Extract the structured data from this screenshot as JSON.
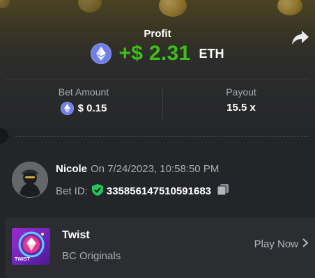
{
  "hero": {
    "title": "Profit",
    "profit_value": "+$ 2.31",
    "profit_unit": "ETH"
  },
  "stats": {
    "bet_amount_label": "Bet Amount",
    "bet_amount_value": "$ 0.15",
    "payout_label": "Payout",
    "payout_value": "15.5 x"
  },
  "user": {
    "name": "Nicole",
    "date": "On 7/24/2023, 10:58:50 PM",
    "bet_id_label": "Bet ID:",
    "bet_id": "335856147510591683"
  },
  "game": {
    "name": "Twist",
    "provider": "BC Originals",
    "thumb_label": "TWIST",
    "play_label": "Play Now"
  },
  "colors": {
    "profit_green": "#3bc117",
    "eth_blue": "#6f7fe3",
    "shield_green": "#22c55e",
    "background": "#232528",
    "card": "#2b2d31"
  },
  "icons": {
    "currency": "eth-icon",
    "share": "share-icon",
    "verified": "shield-check-icon",
    "copy": "copy-icon",
    "chevron": "chevron-right-icon"
  }
}
